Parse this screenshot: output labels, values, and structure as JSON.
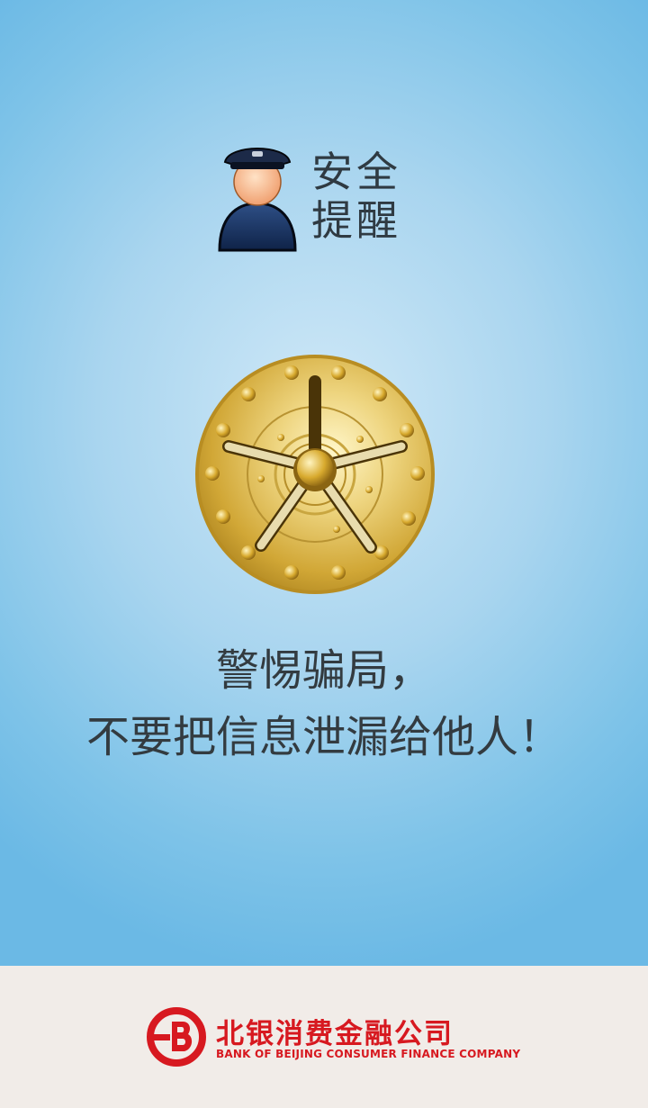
{
  "header": {
    "title": "安全提醒",
    "icon": "security-guard-icon"
  },
  "safe": {
    "icon": "vault-safe-icon"
  },
  "warning": {
    "line1": "警惕骗局，",
    "line2": "不要把信息泄漏给他人！"
  },
  "footer": {
    "logo_icon": "bank-logo-icon",
    "company_cn": "北银消费金融公司",
    "company_en": "BANK OF BEIJING CONSUMER FINANCE COMPANY"
  },
  "colors": {
    "brand_red": "#d71920",
    "sky_blue": "#6bb9e5",
    "footer_bg": "#f1ece8",
    "gold": "#d4b23a"
  }
}
